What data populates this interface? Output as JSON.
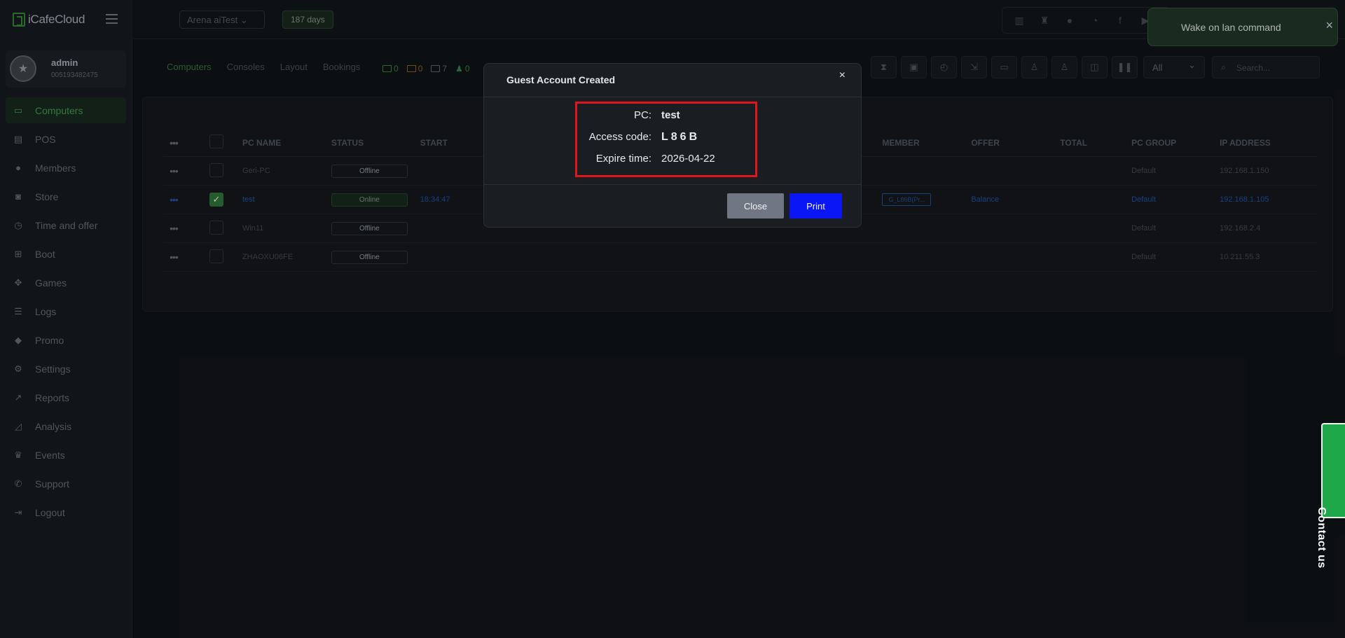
{
  "app": {
    "logo_text": "iCafeCloud"
  },
  "user": {
    "name": "admin",
    "id": "005193482475"
  },
  "sidebar": {
    "items": [
      {
        "label": "Computers",
        "icon": "monitor-icon",
        "active": true
      },
      {
        "label": "POS",
        "icon": "cash-register-icon"
      },
      {
        "label": "Members",
        "icon": "users-icon"
      },
      {
        "label": "Store",
        "icon": "shopping-bag-icon"
      },
      {
        "label": "Time and offer",
        "icon": "clock-icon"
      },
      {
        "label": "Boot",
        "icon": "windows-icon"
      },
      {
        "label": "Games",
        "icon": "gamepad-icon"
      },
      {
        "label": "Logs",
        "icon": "list-icon"
      },
      {
        "label": "Promo",
        "icon": "tag-icon"
      },
      {
        "label": "Settings",
        "icon": "gear-icon"
      },
      {
        "label": "Reports",
        "icon": "line-chart-icon"
      },
      {
        "label": "Analysis",
        "icon": "area-chart-icon"
      },
      {
        "label": "Events",
        "icon": "crown-icon"
      },
      {
        "label": "Support",
        "icon": "phone-icon"
      },
      {
        "label": "Logout",
        "icon": "logout-icon"
      }
    ]
  },
  "topbar": {
    "center_select": "Arena aiTest",
    "days_badge": "187 days"
  },
  "toast": {
    "text": "Wake on lan command",
    "close": "×"
  },
  "tabs": [
    {
      "label": "Computers",
      "active": true
    },
    {
      "label": "Consoles"
    },
    {
      "label": "Layout"
    },
    {
      "label": "Bookings"
    }
  ],
  "counters": {
    "online_pcs": "0",
    "warning_pcs": "0",
    "total_pcs": "7",
    "users": "0"
  },
  "filter": {
    "selected": "All"
  },
  "search": {
    "placeholder": "Search..."
  },
  "table": {
    "headers": {
      "name": "PC NAME",
      "status": "STATUS",
      "start": "START",
      "member": "MEMBER",
      "offer": "OFFER",
      "total": "TOTAL",
      "group": "PC GROUP",
      "ip": "IP ADDRESS"
    },
    "rows": [
      {
        "name": "Geri-PC",
        "status": "Offline",
        "start": "",
        "member": "",
        "offer": "",
        "group": "Default",
        "ip": "192.168.1.150",
        "checked": false
      },
      {
        "name": "test",
        "status": "Online",
        "start": "18:34:47",
        "member": "G_L86B(Pr...",
        "offer": "Balance",
        "group": "Default",
        "ip": "192.168.1.105",
        "checked": true
      },
      {
        "name": "Win11",
        "status": "Offline",
        "start": "",
        "member": "",
        "offer": "",
        "group": "Default",
        "ip": "192.168.2.4",
        "checked": false
      },
      {
        "name": "ZHAOXU06FE",
        "status": "Offline",
        "start": "",
        "member": "",
        "offer": "",
        "group": "Default",
        "ip": "10.211.55.3",
        "checked": false
      }
    ]
  },
  "modal": {
    "title": "Guest Account Created",
    "close_icon": "×",
    "pc_label": "PC:",
    "pc_value": "test",
    "code_label": "Access code:",
    "code_value": "L86B",
    "expire_label": "Expire time:",
    "expire_value": "2026-04-22",
    "close_button": "Close",
    "print_button": "Print"
  },
  "contact": {
    "label": "Contact us"
  },
  "colors": {
    "accent_green": "#2e7d32",
    "print_blue": "#0b16f5",
    "highlight_red": "#e0161b",
    "contact_green": "#1fa84a"
  }
}
